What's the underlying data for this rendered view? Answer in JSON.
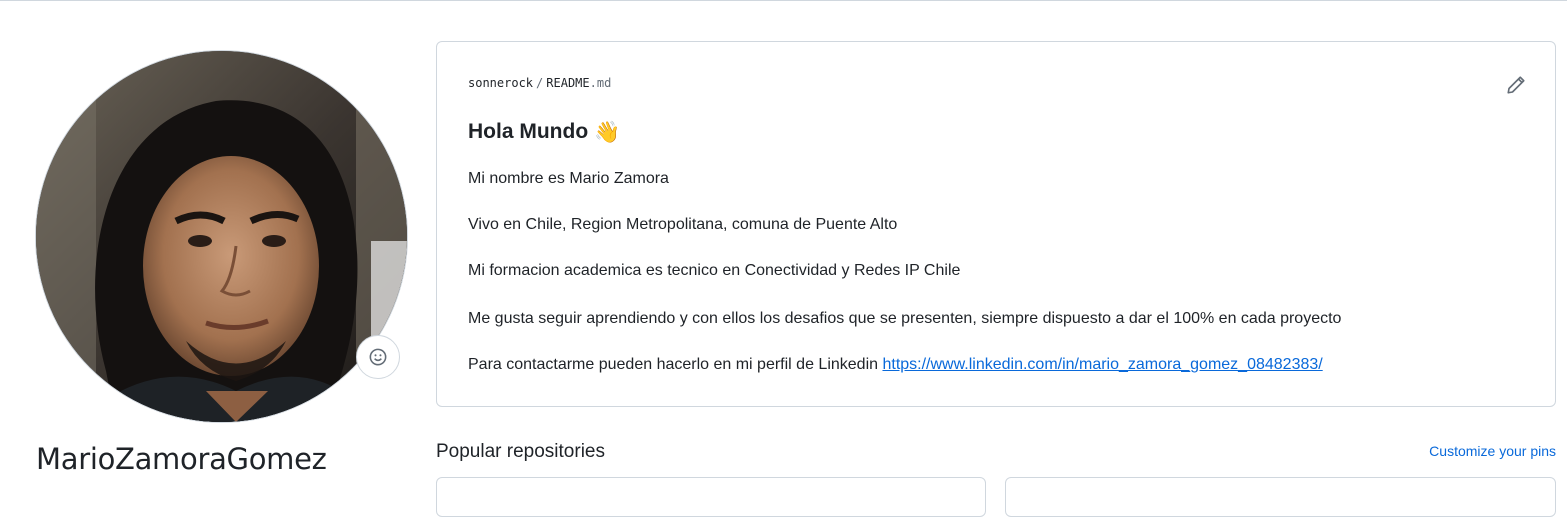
{
  "profile": {
    "username": "MarioZamoraGomez",
    "avatar_icon": "profile-photo",
    "status_icon": "smiley-icon"
  },
  "readme": {
    "owner": "sonnerock",
    "separator": "/",
    "file_name": "README",
    "file_ext": ".md",
    "edit_icon": "pencil-icon",
    "heading": "Hola Mundo",
    "heading_emoji": "👋",
    "paragraphs": [
      "Mi nombre es Mario Zamora",
      "Vivo en Chile, Region Metropolitana, comuna de Puente Alto",
      "Mi formacion academica es tecnico en Conectividad y Redes IP Chile",
      "Me gusta seguir aprendiendo y con ellos los desafios que se presenten, siempre dispuesto a dar el 100% en cada proyecto"
    ],
    "contact_text": "Para contactarme pueden hacerlo en mi perfil de Linkedin ",
    "contact_link": "https://www.linkedin.com/in/mario_zamora_gomez_08482383/"
  },
  "popular": {
    "title": "Popular repositories",
    "customize_label": "Customize your pins"
  },
  "colors": {
    "border": "#d0d7de",
    "link": "#0969da",
    "text": "#1f2328"
  }
}
